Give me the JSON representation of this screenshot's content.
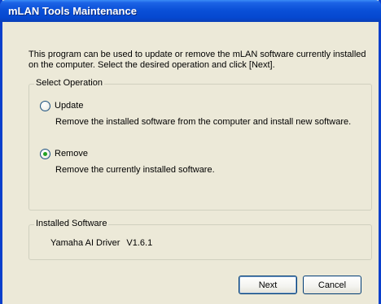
{
  "window": {
    "title": "mLAN Tools Maintenance"
  },
  "description": {
    "line1": "This program can be used to update or remove the mLAN software currently installed",
    "line2": "on the computer. Select the desired operation and click [Next]."
  },
  "select_operation": {
    "legend": "Select Operation",
    "options": [
      {
        "label": "Update",
        "description": "Remove the installed software from the computer and install new software.",
        "selected": false
      },
      {
        "label": "Remove",
        "description": "Remove the currently installed software.",
        "selected": true
      }
    ]
  },
  "installed_software": {
    "legend": "Installed Software",
    "name": "Yamaha AI Driver",
    "version": "V1.6.1"
  },
  "buttons": {
    "next_label": "Next",
    "cancel_label": "Cancel"
  },
  "colors": {
    "titlebar": "#0a50d8",
    "window_bg": "#ece9d8",
    "selected_radio": "#21a121"
  }
}
